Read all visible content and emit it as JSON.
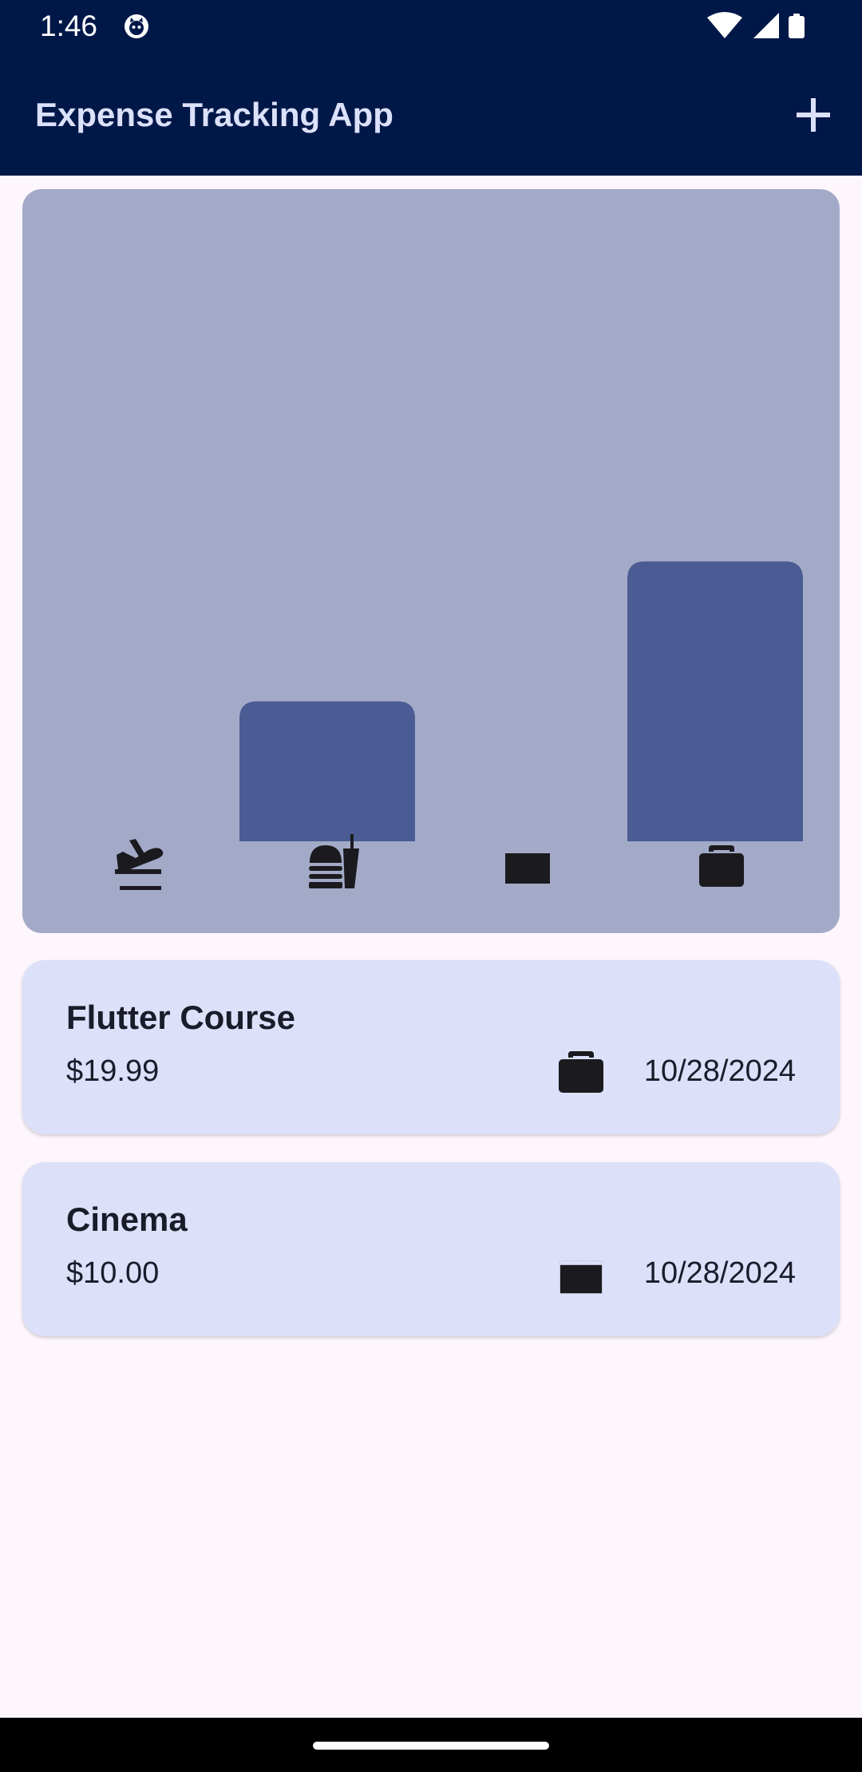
{
  "status_bar": {
    "time": "1:46",
    "icons": [
      "cat-icon",
      "wifi-icon",
      "signal-icon",
      "battery-icon"
    ]
  },
  "app_bar": {
    "title": "Expense Tracking App",
    "add_icon": "plus-icon"
  },
  "colors": {
    "app_bar_bg": "#001848",
    "chart_bg": "#A3AAC8",
    "bar_fill": "#4A5C93",
    "card_bg": "#DCE0F9",
    "page_bg": "#FDF6FD"
  },
  "chart_data": {
    "type": "bar",
    "categories": [
      "travel",
      "food",
      "leisure",
      "work"
    ],
    "category_icons": [
      "flight-takeoff-icon",
      "fastfood-icon",
      "movie-icon",
      "work-icon"
    ],
    "values": [
      0,
      10.0,
      0,
      19.99
    ],
    "ylim": [
      0,
      29.99
    ]
  },
  "expenses": [
    {
      "title": "Flutter Course",
      "amount": "$19.99",
      "date": "10/28/2024",
      "icon": "work-icon"
    },
    {
      "title": "Cinema",
      "amount": "$10.00",
      "date": "10/28/2024",
      "icon": "movie-icon"
    }
  ]
}
